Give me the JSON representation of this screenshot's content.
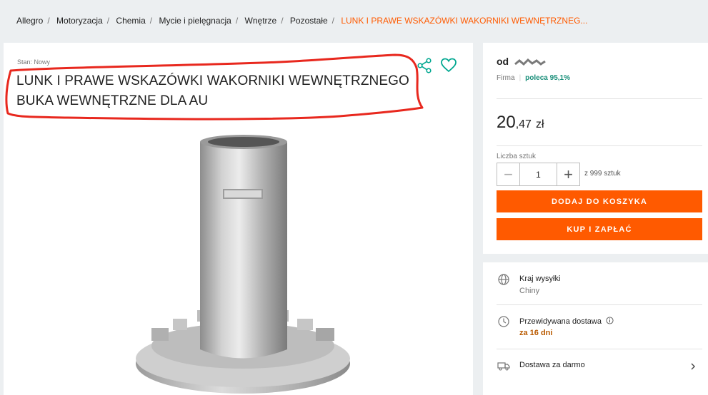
{
  "breadcrumb": {
    "items": [
      "Allegro",
      "Motoryzacja",
      "Chemia",
      "Mycie i pielęgnacja",
      "Wnętrze",
      "Pozostałe"
    ],
    "current": "LUNK I PRAWE WSKAZÓWKI WAKORNIKI WEWNĘTRZNEG..."
  },
  "product": {
    "condition_label": "Stan:",
    "condition_value": "Nowy",
    "title": "LUNK I PRAWE WSKAZÓWKI WAKORNIKI WEWNĘTRZNEGO BUKA WEWNĘTRZNE DLA AU",
    "icons": [
      "share-icon",
      "heart-icon"
    ]
  },
  "seller": {
    "prefix": "od",
    "type": "Firma",
    "recommend": "poleca 95,1%"
  },
  "price": {
    "integer": "20",
    "decimal": ",47",
    "currency": "zł"
  },
  "quantity": {
    "label": "Liczba sztuk",
    "value": "1",
    "available": "z 999 sztuk"
  },
  "actions": {
    "add_to_cart": "DODAJ DO KOSZYKA",
    "buy_now": "KUP I ZAPŁAĆ"
  },
  "shipping": {
    "country_label": "Kraj wysyłki",
    "country_value": "Chiny",
    "delivery_label": "Przewidywana dostawa",
    "delivery_value": "za 16 dni",
    "free_delivery": "Dostawa za darmo"
  },
  "colors": {
    "accent": "#ff5a00",
    "teal": "#1a8f7a",
    "annotation": "#e8281e"
  }
}
